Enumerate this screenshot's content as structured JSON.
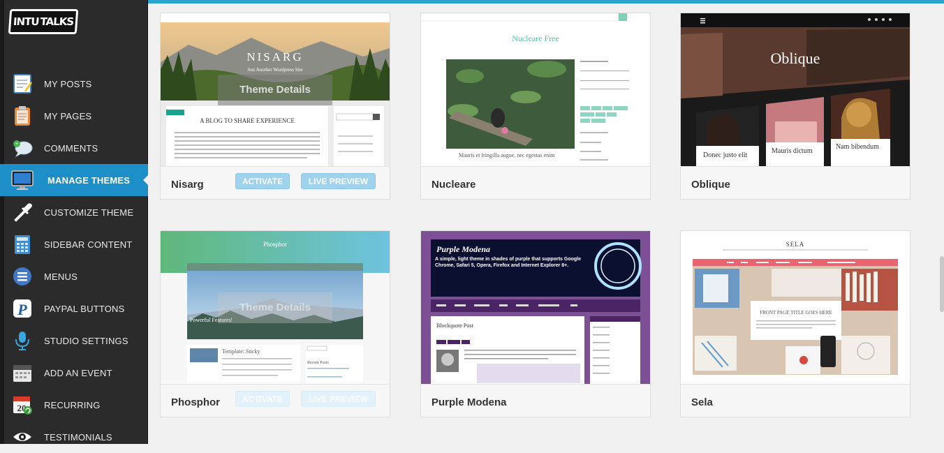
{
  "brand": {
    "logo_left": "INTU",
    "logo_right": "TALKS"
  },
  "sidebar": {
    "items": [
      {
        "label": "MY POSTS",
        "icon": "notepad-icon",
        "active": false
      },
      {
        "label": "MY PAGES",
        "icon": "clipboard-icon",
        "active": false
      },
      {
        "label": "COMMENTS",
        "icon": "speech-bubble-icon",
        "active": false
      },
      {
        "label": "MANAGE THEMES",
        "icon": "monitor-icon",
        "active": true
      },
      {
        "label": "CUSTOMIZE THEME",
        "icon": "eyedropper-icon",
        "active": false
      },
      {
        "label": "SIDEBAR CONTENT",
        "icon": "calculator-icon",
        "active": false
      },
      {
        "label": "MENUS",
        "icon": "list-icon",
        "active": false
      },
      {
        "label": "PAYPAL BUTTONS",
        "icon": "paypal-icon",
        "active": false
      },
      {
        "label": "STUDIO SETTINGS",
        "icon": "microphone-icon",
        "active": false
      },
      {
        "label": "ADD AN EVENT",
        "icon": "calendar-icon",
        "active": false
      },
      {
        "label": "RECURRING",
        "icon": "recurring-calendar-icon",
        "active": false
      },
      {
        "label": "TESTIMONIALS",
        "icon": "eye-icon",
        "active": false
      }
    ]
  },
  "themes": [
    {
      "name": "Nisarg",
      "thumb_title": "NISARG",
      "thumb_subtitle": "Just Another Wordpress Site",
      "thumb_heading": "A BLOG TO SHARE EXPERIENCE"
    },
    {
      "name": "Nucleare",
      "thumb_title": "Nucleare Free",
      "thumb_caption": "Mauris et fringilla augue, nec egestas enim"
    },
    {
      "name": "Oblique",
      "thumb_title": "Oblique",
      "thumb_cap1": "Donec justo elit",
      "thumb_cap2": "Mauris dictum",
      "thumb_cap3": "Nam bibendum"
    },
    {
      "name": "Phosphor",
      "thumb_title": "Phosphor",
      "thumb_caption": "Powerful Features!",
      "thumb_post": "Template: Sticky",
      "thumb_recent": "Recent Posts"
    },
    {
      "name": "Purple Modena",
      "thumb_title": "Purple Modena",
      "thumb_tagline": "A simple, light theme in shades of purple that supports Google Chrome, Safari 5, Opera, Firefox and Internet Explorer 8+.",
      "thumb_post": "Blockquote Post"
    },
    {
      "name": "Sela",
      "thumb_title": "SELA",
      "thumb_heading": "FRONT PAGE TITLE GOES HERE"
    }
  ],
  "actions": {
    "details": "Theme Details",
    "activate": "ACTIVATE",
    "preview": "LIVE PREVIEW"
  }
}
